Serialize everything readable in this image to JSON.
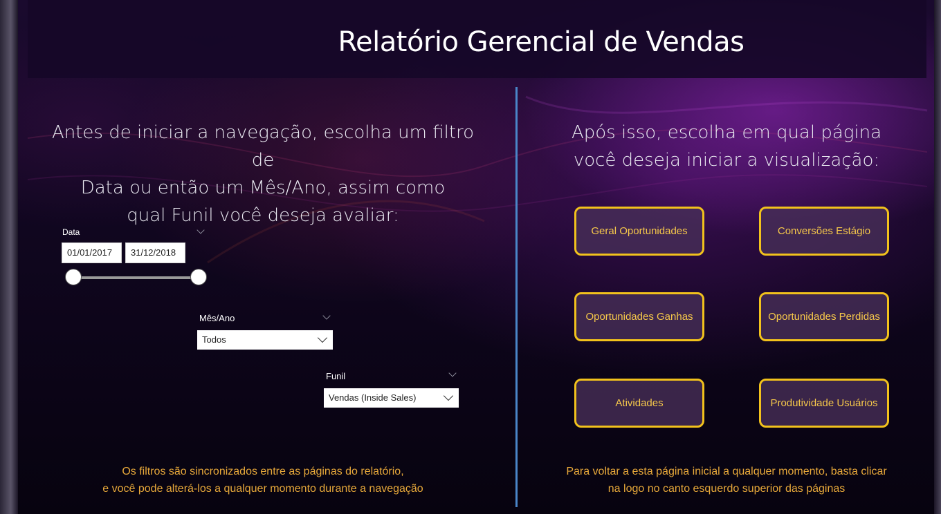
{
  "header": {
    "title": "Relatório Gerencial de Vendas"
  },
  "left": {
    "intro_lines": [
      "Antes de iniciar a navegação, escolha um filtro de",
      "Data ou então um Mês/Ano, assim como",
      "qual Funil você deseja avaliar:"
    ],
    "date_slicer": {
      "title": "Data",
      "start": "01/01/2017",
      "end": "31/12/2018",
      "range_fraction": [
        0.0,
        1.0
      ]
    },
    "month_slicer": {
      "title": "Mês/Ano",
      "value": "Todos"
    },
    "funnel_slicer": {
      "title": "Funil",
      "value": "Vendas (Inside Sales)"
    },
    "footer_lines": [
      "Os filtros são sincronizados entre as páginas do relatório,",
      "e você pode alterá-los a qualquer momento durante a navegação"
    ]
  },
  "right": {
    "intro_lines": [
      "Após isso, escolha em qual página",
      "você deseja iniciar a visualização:"
    ],
    "buttons": [
      "Geral Oportunidades",
      "Conversões Estágio",
      "Oportunidades Ganhas",
      "Oportunidades Perdidas",
      "Atividades",
      "Produtividade Usuários"
    ],
    "footer_lines": [
      "Para voltar a esta página inicial a qualquer momento, basta clicar",
      "na logo no canto esquerdo superior das páginas"
    ]
  },
  "colors": {
    "accent_button_border": "#f2c21c",
    "button_text": "#f6c84a",
    "footer_text": "#e8a93a",
    "divider": "#4a86c8"
  }
}
